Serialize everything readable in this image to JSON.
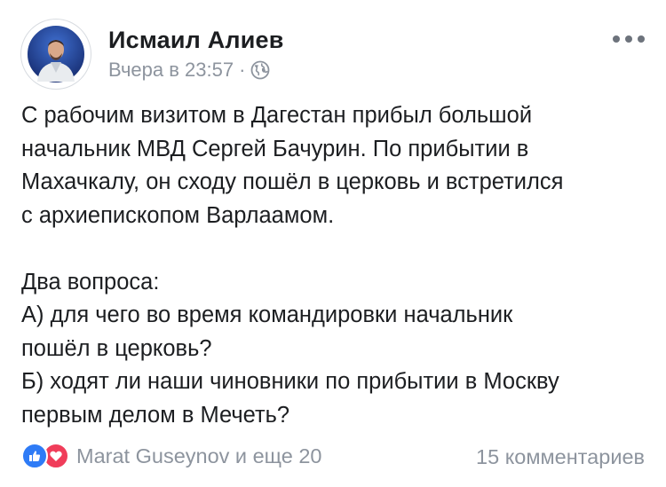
{
  "post": {
    "author": "Исмаил Алиев",
    "timestamp": "Вчера в 23:57",
    "meta_separator": "·",
    "privacy_icon": "globe-icon",
    "more_icon": "more-options-icon",
    "paragraphs": [
      "С рабочим визитом в Дагестан прибыл большой\nначальник МВД Сергей Бачурин. По прибытии в\nМахачкалу, он сходу пошёл в церковь и встретился\nс архиепископом Варлаамом.",
      "Два вопроса:\nА) для чего во время командировки начальник\nпошёл в церковь?\nБ) ходят ли наши чиновники по прибытии в Москву\nпервым делом в Мечеть?"
    ]
  },
  "footer": {
    "reaction_icons": [
      "like-icon",
      "love-icon"
    ],
    "reactions_text": "Marat Guseynov и еще 20",
    "comments_text": "15 комментариев"
  },
  "colors": {
    "text": "#1c1e21",
    "meta": "#8d949e",
    "like": "#2e7bf6",
    "love": "#f03d5a"
  }
}
